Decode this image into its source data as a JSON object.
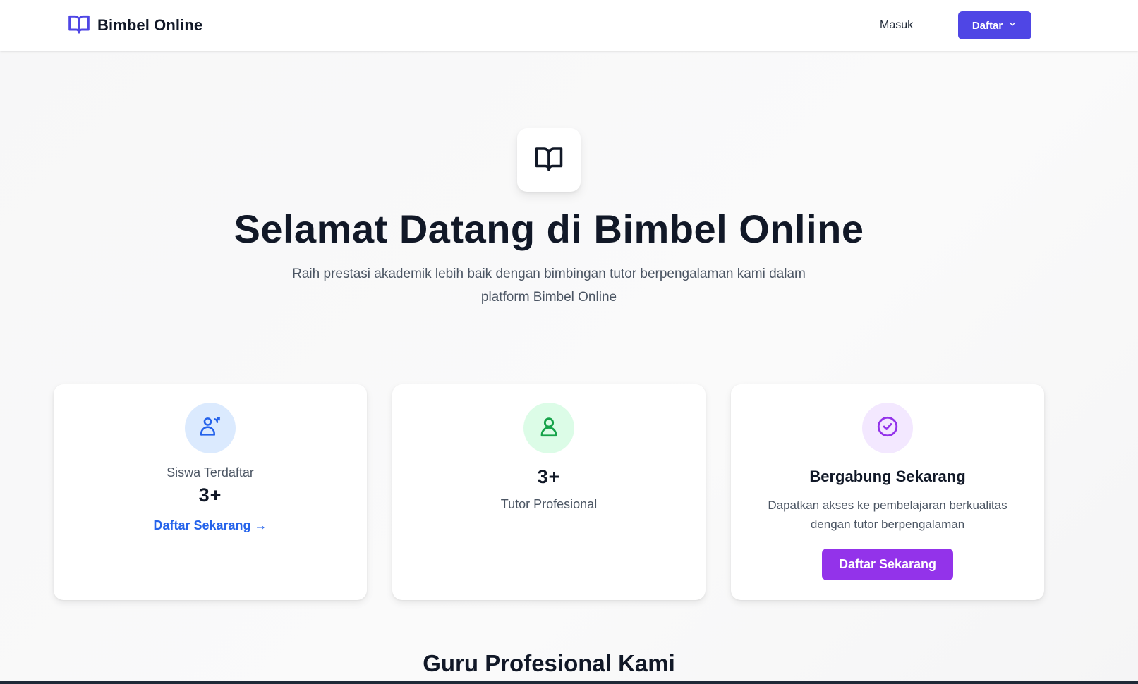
{
  "navbar": {
    "brand_name": "Bimbel Online",
    "brand_icon": "book-open-icon",
    "login_label": "Masuk",
    "register_label": "Daftar",
    "accent_color": "#4f46e5"
  },
  "hero": {
    "icon": "book-open-icon",
    "title": "Selamat Datang di Bimbel Online",
    "subtitle": "Raih prestasi akademik lebih baik dengan bimbingan tutor berpengalaman kami dalam platform Bimbel Online"
  },
  "cards": {
    "students": {
      "icon": "students-icon",
      "label": "Siswa Terdaftar",
      "value": "3+",
      "link_label": "Daftar Sekarang →",
      "icon_color": "#2563eb"
    },
    "tutors": {
      "icon": "user-icon",
      "value": "3+",
      "label": "Tutor Profesional",
      "icon_color": "#16a34a"
    },
    "join": {
      "icon": "check-circle-icon",
      "heading": "Bergabung Sekarang",
      "description": "Dapatkan akses ke pembelajaran berkualitas dengan tutor berpengalaman",
      "button_label": "Daftar Sekarang",
      "icon_color": "#9333ea"
    }
  },
  "section": {
    "title": "Guru Profesional Kami"
  }
}
